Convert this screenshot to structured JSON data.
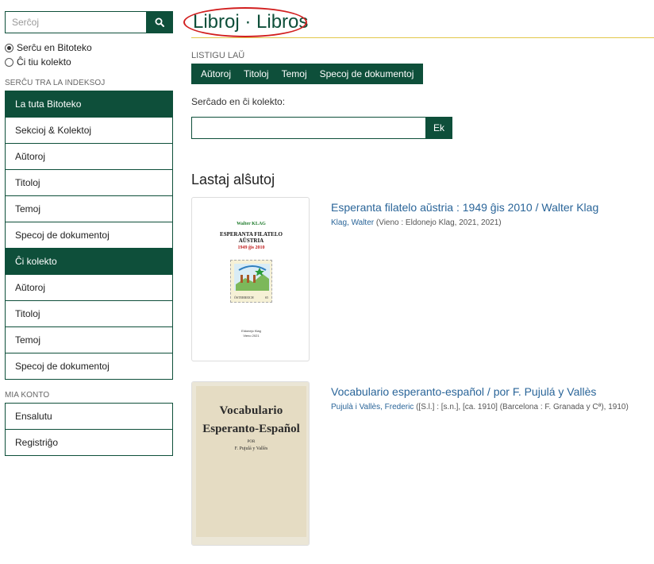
{
  "sidebar": {
    "search": {
      "placeholder": "Serĉoj",
      "button_icon": "search-icon"
    },
    "scope_options": [
      {
        "label": "Serĉu en Bitoteko",
        "checked": true
      },
      {
        "label": "Ĉi tiu kolekto",
        "checked": false
      }
    ],
    "index_heading": "SERĈU TRA LA INDEKSOJ",
    "index_items": [
      {
        "label": "La tuta Bitoteko",
        "active": true
      },
      {
        "label": "Sekcioj & Kolektoj",
        "active": false
      },
      {
        "label": "Aŭtoroj",
        "active": false
      },
      {
        "label": "Titoloj",
        "active": false
      },
      {
        "label": "Temoj",
        "active": false
      },
      {
        "label": "Specoj de dokumentoj",
        "active": false
      },
      {
        "label": "Ĉi kolekto",
        "active": true
      },
      {
        "label": "Aŭtoroj",
        "active": false
      },
      {
        "label": "Titoloj",
        "active": false
      },
      {
        "label": "Temoj",
        "active": false
      },
      {
        "label": "Specoj de dokumentoj",
        "active": false
      }
    ],
    "account_heading": "MIA KONTO",
    "account_items": [
      {
        "label": "Ensalutu"
      },
      {
        "label": "Registriĝo"
      }
    ]
  },
  "main": {
    "title": "Libroj · Libros",
    "browse_heading": "LISTIGU LAŬ",
    "browse_items": [
      "Aŭtoroj",
      "Titoloj",
      "Temoj",
      "Specoj de dokumentoj"
    ],
    "collection_search_label": "Serĉado en ĉi kolekto:",
    "collection_search_value": "",
    "collection_search_button": "Ek",
    "recent_heading": "Lastaj alŝutoj",
    "items": [
      {
        "title": "Esperanta filatelo aŭstria : 1949 ĝis 2010 / Walter Klag",
        "author": "Klag, Walter",
        "meta": " (Vieno : Eldonejo Klag, 2021, 2021)",
        "cover": {
          "author": "Walter KLAG",
          "title_line1": "ESPERANTA FILATELO",
          "title_line2": "AŬSTRIA",
          "years": "1949 ĝis 2010",
          "stamp_left": "ÖSTERREICH",
          "stamp_right": "S5",
          "publisher_line1": "Eldonejo Klag",
          "publisher_line2": "Vieno 2021"
        }
      },
      {
        "title": "Vocabulario esperanto-español / por F. Pujulá y Vallès",
        "author": "Pujulà i Vallès, Frederic",
        "meta": " ([S.l.] : [s.n.], [ca. 1910] (Barcelona : F. Granada y Cª), 1910)",
        "cover": {
          "line1": "Vocabulario",
          "line2": "Esperanto-Español",
          "por": "POR",
          "author": "F. Pujulá y Vallès"
        }
      }
    ]
  },
  "colors": {
    "primary": "#0e4f3a",
    "link": "#2a6599",
    "title_underline": "#e3c84a",
    "annotation_oval": "#d21f1f"
  }
}
